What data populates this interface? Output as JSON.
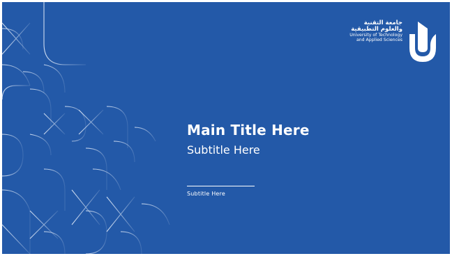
{
  "slide": {
    "title": "Main Title Here",
    "subtitle": "Subtitle Here",
    "small_subtitle": "Subtitle Here"
  },
  "logo": {
    "arabic_line1": "جامعة التقنية",
    "arabic_line2": "والعلوم التطبيقية",
    "english_line1": "University of Technology",
    "english_line2": "and Applied Sciences",
    "mark_icon": "utas-logo-mark"
  },
  "colors": {
    "background": "#2359a8",
    "foreground": "#ffffff",
    "pattern_stroke": "#c9d8ee"
  }
}
